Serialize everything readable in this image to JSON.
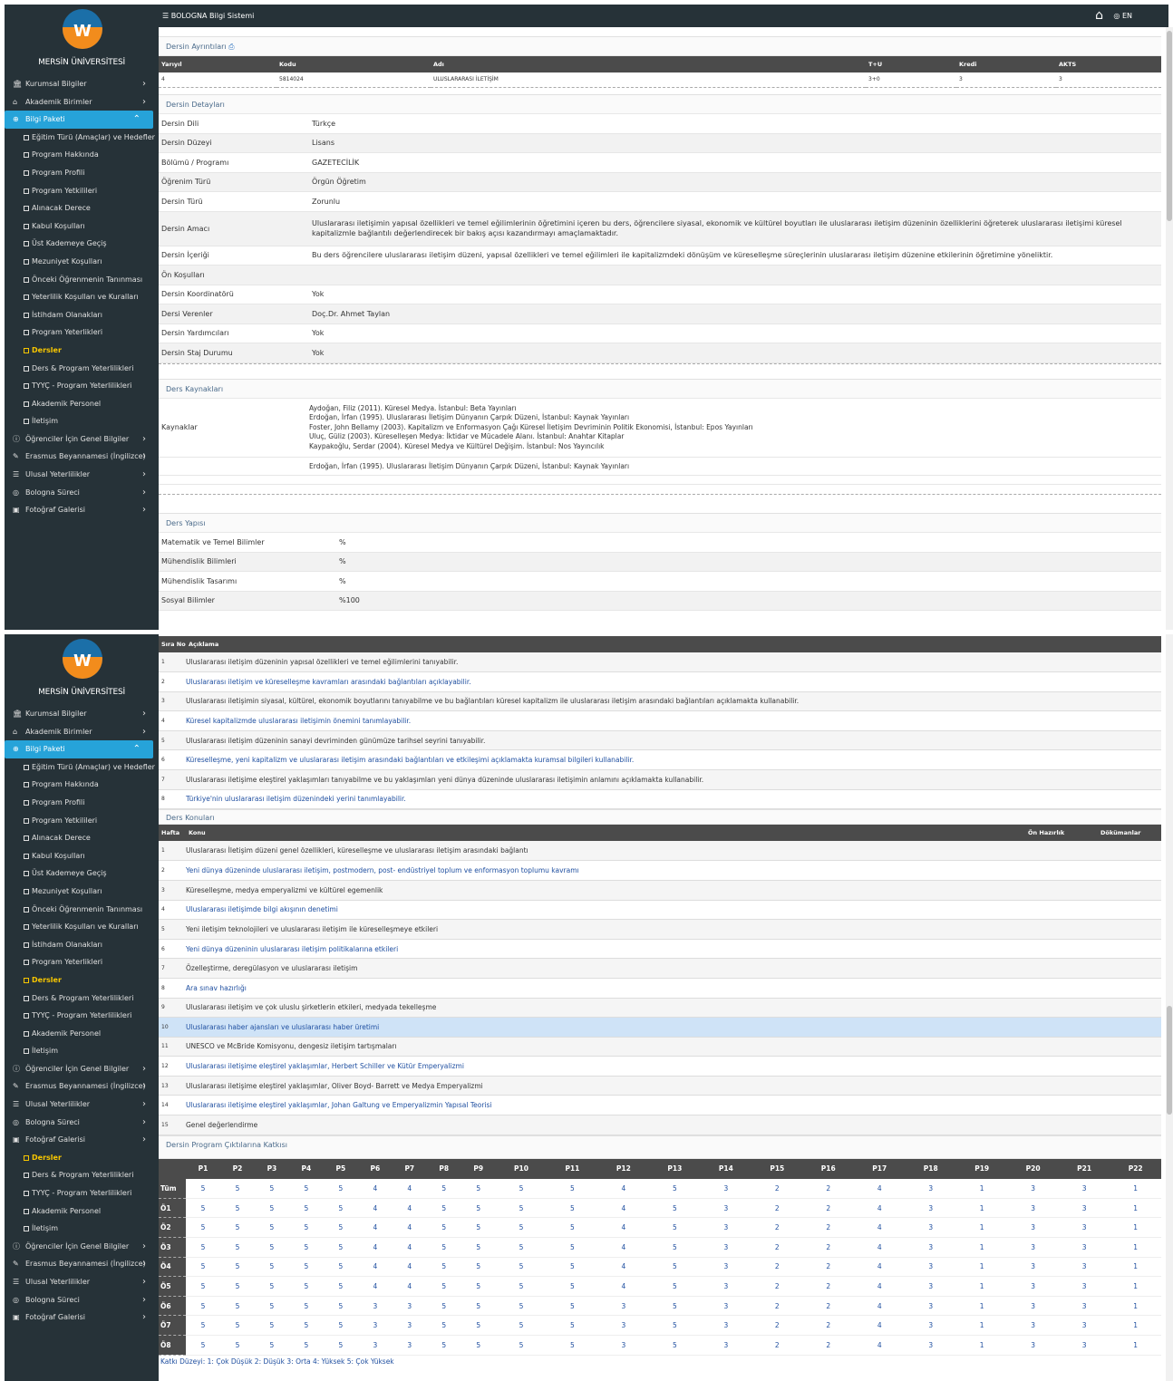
{
  "app": {
    "title": "BOLOGNA Bilgi Sistemi",
    "university": "MERSİN ÜNİVERSİTESİ",
    "lang": "EN"
  },
  "sidebar": {
    "top": [
      {
        "label": "Kurumsal Bilgiler",
        "icon": "institution-icon"
      },
      {
        "label": "Akademik Birimler",
        "icon": "building-icon"
      },
      {
        "label": "Bilgi Paketi",
        "icon": "globe-icon"
      }
    ],
    "sub": [
      "Eğitim Türü (Amaçlar) ve Hedefler",
      "Program Hakkında",
      "Program Profili",
      "Program Yetkilileri",
      "Alınacak Derece",
      "Kabul Koşulları",
      "Üst Kademeye Geçiş",
      "Mezuniyet Koşulları",
      "Önceki Öğrenmenin Tanınması",
      "Yeterlilik Koşulları ve Kuralları",
      "İstihdam Olanakları",
      "Program Yeterlikleri",
      "Dersler",
      "Ders & Program Yeterlilikleri",
      "TYYÇ - Program Yeterlilikleri",
      "Akademik Personel",
      "İletişim"
    ],
    "bottom": [
      "Öğrenciler İçin Genel Bilgiler",
      "Erasmus Beyannamesi (İngilizce)",
      "Ulusal Yeterlilikler",
      "Bologna Süreci",
      "Fotoğraf Galerisi"
    ],
    "extra_sub": [
      "Dersler",
      "Ders & Program Yeterlilikleri",
      "TYYÇ - Program Yeterlilikleri",
      "Akademik Personel",
      "İletişim"
    ]
  },
  "course": {
    "panel_title": "Dersin Ayrıntıları",
    "headers": [
      "Yarıyıl",
      "Kodu",
      "Adı",
      "T+U",
      "Kredi",
      "AKTS"
    ],
    "row": [
      "4",
      "5814024",
      "ULUSLARARASI İLETİŞİM",
      "3+0",
      "3",
      "3"
    ]
  },
  "details": {
    "panel_title": "Dersin Detayları",
    "rows": [
      [
        "Dersin Dili",
        "Türkçe"
      ],
      [
        "Dersin Düzeyi",
        "Lisans"
      ],
      [
        "Bölümü / Programı",
        "GAZETECİLİK"
      ],
      [
        "Öğrenim Türü",
        "Örgün Öğretim"
      ],
      [
        "Dersin Türü",
        "Zorunlu"
      ],
      [
        "Dersin Amacı",
        "Uluslararası iletişimin yapısal özellikleri ve temel eğilimlerinin öğretimini içeren bu ders, öğrencilere siyasal, ekonomik ve kültürel boyutları ile uluslararası iletişim düzeninin özelliklerini öğreterek uluslararası iletişimi küresel kapitalizmle bağlantılı değerlendirecek bir bakış açısı kazandırmayı amaçlamaktadır."
      ],
      [
        "Dersin İçeriği",
        "Bu ders öğrencilere uluslararası iletişim düzeni, yapısal özellikleri ve temel eğilimleri ile kapitalizmdeki dönüşüm ve küreselleşme süreçlerinin uluslararası iletişim düzenine etkilerinin öğretimine yöneliktir."
      ],
      [
        "Ön Koşulları",
        ""
      ],
      [
        "Dersin Koordinatörü",
        "Yok"
      ],
      [
        "Dersi Verenler",
        "Doç.Dr. Ahmet Taylan"
      ],
      [
        "Dersin Yardımcıları",
        "Yok"
      ],
      [
        "Dersin Staj Durumu",
        "Yok"
      ]
    ]
  },
  "sources": {
    "panel_title": "Ders Kaynakları",
    "label": "Kaynaklar",
    "lines": [
      "Aydoğan, Filiz (2011). Küresel Medya. İstanbul: Beta Yayınları",
      "Erdoğan, İrfan (1995). Uluslararası İletişim Dünyanın Çarpık Düzeni, İstanbul: Kaynak Yayınları",
      "Foster, John Bellamy (2003). Kapitalizm ve Enformasyon Çağı Küresel İletişim Devriminin Politik Ekonomisi, İstanbul: Epos Yayınları",
      "Uluç, Güliz (2003). Küreselleşen Medya: İktidar ve Mücadele Alanı. İstanbul: Anahtar Kitaplar",
      "Kaypakoğlu, Serdar (2004). Küresel Medya ve Kültürel Değişim. İstanbul: Nos Yayıncılık"
    ],
    "extra": "Erdoğan, İrfan (1995). Uluslararası İletişim Dünyanın Çarpık Düzeni, İstanbul: Kaynak Yayınları"
  },
  "structure": {
    "panel_title": "Ders Yapısı",
    "rows": [
      [
        "Matematik ve Temel Bilimler",
        "%"
      ],
      [
        "Mühendislik Bilimleri",
        "%"
      ],
      [
        "Mühendislik Tasarımı",
        "%"
      ],
      [
        "Sosyal Bilimler",
        "%100"
      ]
    ]
  },
  "outcomes": {
    "headers": [
      "Sıra No",
      "Açıklama"
    ],
    "rows": [
      [
        "1",
        "Uluslararası iletişim düzeninin yapısal özellikleri ve temel eğilimlerini tanıyabilir."
      ],
      [
        "2",
        "Uluslararası iletişim ve küreselleşme kavramları arasındaki bağlantıları açıklayabilir."
      ],
      [
        "3",
        "Uluslararası iletişimin siyasal, kültürel, ekonomik boyutlarını tanıyabilme ve bu bağlantıları küresel kapitalizm ile uluslararası iletişim arasındaki bağlantıları açıklamakta kullanabilir."
      ],
      [
        "4",
        "Küresel kapitalizmde uluslararası iletişimin önemini tanımlayabilir."
      ],
      [
        "5",
        "Uluslararası iletişim düzeninin sanayi devriminden günümüze tarihsel seyrini tanıyabilir."
      ],
      [
        "6",
        "Küreselleşme, yeni kapitalizm ve uluslararası iletişim arasındaki bağlantıları ve etkileşimi açıklamakta kuramsal bilgileri kullanabilir."
      ],
      [
        "7",
        "Uluslararası iletişime eleştirel yaklaşımları tanıyabilme ve bu yaklaşımları yeni dünya düzeninde uluslararası iletişimin anlamını açıklamakta kullanabilir."
      ],
      [
        "8",
        "Türkiye'nin uluslararası iletişim düzenindeki yerini tanımlayabilir."
      ]
    ]
  },
  "topics": {
    "panel_title": "Ders Konuları",
    "headers": [
      "Hafta",
      "Konu",
      "Ön Hazırlık",
      "Dökümanlar"
    ],
    "rows": [
      [
        "1",
        "Uluslararası İletişim düzeni genel özellikleri, küreselleşme ve uluslararası iletişim arasındaki bağlantı"
      ],
      [
        "2",
        "Yeni dünya düzeninde uluslararası iletişim, postmodern, post- endüstriyel toplum ve enformasyon toplumu kavramı"
      ],
      [
        "3",
        "Küreselleşme, medya emperyalizmi ve kültürel egemenlik"
      ],
      [
        "4",
        "Uluslararası iletişimde bilgi akışının denetimi"
      ],
      [
        "5",
        "Yeni iletişim teknolojileri ve uluslararası iletişim ile küreselleşmeye etkileri"
      ],
      [
        "6",
        "Yeni dünya düzeninin uluslararası iletişim politikalarına etkileri"
      ],
      [
        "7",
        "Özelleştirme, deregülasyon ve uluslararası iletişim"
      ],
      [
        "8",
        "Ara sınav hazırlığı"
      ],
      [
        "9",
        "Uluslararası iletişim ve çok uluslu şirketlerin etkileri, medyada tekelleşme"
      ],
      [
        "10",
        "Uluslararası haber ajansları ve uluslararası haber üretimi"
      ],
      [
        "11",
        "UNESCO ve McBride Komisyonu, dengesiz iletişim tartışmaları"
      ],
      [
        "12",
        "Uluslararası iletişime eleştirel yaklaşımlar, Herbert Schiller ve Kütür Emperyalizmi"
      ],
      [
        "13",
        "Uluslararası iletişime eleştirel yaklaşımlar, Oliver Boyd- Barrett ve Medya Emperyalizmi"
      ],
      [
        "14",
        "Uluslararası iletişime eleştirel yaklaşımlar, Johan Galtung ve Emperyalizmin Yapısal Teorisi"
      ],
      [
        "15",
        "Genel değerlendirme"
      ]
    ]
  },
  "matrix": {
    "panel_title": "Dersin Program Çıktılarına Katkısı",
    "cols": [
      "P1",
      "P2",
      "P3",
      "P4",
      "P5",
      "P6",
      "P7",
      "P8",
      "P9",
      "P10",
      "P11",
      "P12",
      "P13",
      "P14",
      "P15",
      "P16",
      "P17",
      "P18",
      "P19",
      "P20",
      "P21",
      "P22"
    ],
    "rows": [
      {
        "label": "Tüm",
        "v": [
          "5",
          "5",
          "5",
          "5",
          "5",
          "4",
          "4",
          "5",
          "5",
          "5",
          "5",
          "4",
          "5",
          "3",
          "2",
          "2",
          "4",
          "3",
          "1",
          "3",
          "3",
          "1"
        ]
      },
      {
        "label": "Ö1",
        "v": [
          "5",
          "5",
          "5",
          "5",
          "5",
          "4",
          "4",
          "5",
          "5",
          "5",
          "5",
          "4",
          "5",
          "3",
          "2",
          "2",
          "4",
          "3",
          "1",
          "3",
          "3",
          "1"
        ]
      },
      {
        "label": "Ö2",
        "v": [
          "5",
          "5",
          "5",
          "5",
          "5",
          "4",
          "4",
          "5",
          "5",
          "5",
          "5",
          "4",
          "5",
          "3",
          "2",
          "2",
          "4",
          "3",
          "1",
          "3",
          "3",
          "1"
        ]
      },
      {
        "label": "Ö3",
        "v": [
          "5",
          "5",
          "5",
          "5",
          "5",
          "4",
          "4",
          "5",
          "5",
          "5",
          "5",
          "4",
          "5",
          "3",
          "2",
          "2",
          "4",
          "3",
          "1",
          "3",
          "3",
          "1"
        ]
      },
      {
        "label": "Ö4",
        "v": [
          "5",
          "5",
          "5",
          "5",
          "5",
          "4",
          "4",
          "5",
          "5",
          "5",
          "5",
          "4",
          "5",
          "3",
          "2",
          "2",
          "4",
          "3",
          "1",
          "3",
          "3",
          "1"
        ]
      },
      {
        "label": "Ö5",
        "v": [
          "5",
          "5",
          "5",
          "5",
          "5",
          "4",
          "4",
          "5",
          "5",
          "5",
          "5",
          "4",
          "5",
          "3",
          "2",
          "2",
          "4",
          "3",
          "1",
          "3",
          "3",
          "1"
        ]
      },
      {
        "label": "Ö6",
        "v": [
          "5",
          "5",
          "5",
          "5",
          "5",
          "3",
          "3",
          "5",
          "5",
          "5",
          "5",
          "3",
          "5",
          "3",
          "2",
          "2",
          "4",
          "3",
          "1",
          "3",
          "3",
          "1"
        ]
      },
      {
        "label": "Ö7",
        "v": [
          "5",
          "5",
          "5",
          "5",
          "5",
          "3",
          "3",
          "5",
          "5",
          "5",
          "5",
          "3",
          "5",
          "3",
          "2",
          "2",
          "4",
          "3",
          "1",
          "3",
          "3",
          "1"
        ]
      },
      {
        "label": "Ö8",
        "v": [
          "5",
          "5",
          "5",
          "5",
          "5",
          "3",
          "3",
          "5",
          "5",
          "5",
          "5",
          "3",
          "5",
          "3",
          "2",
          "2",
          "4",
          "3",
          "1",
          "3",
          "3",
          "1"
        ]
      }
    ],
    "legend": "Katkı Düzeyi: 1: Çok Düşük 2: Düşük 3: Orta 4: Yüksek 5: Çok Yüksek"
  }
}
